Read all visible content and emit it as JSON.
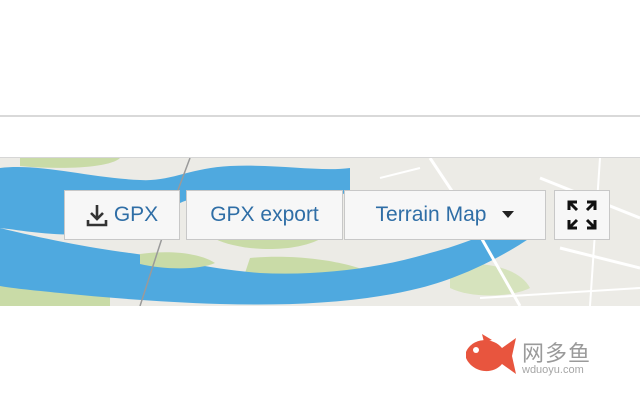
{
  "toolbar": {
    "gpx_label": "GPX",
    "gpx_export_label": "GPX export",
    "map_type_label": "Terrain Map"
  },
  "watermark": {
    "name": "网多鱼",
    "url": "wduoyu.com"
  },
  "colors": {
    "water": "#4fa9df",
    "land": "#ecebe6",
    "park": "#c9dba7",
    "button_text": "#2f6ea6",
    "button_bg": "#f7f7f7",
    "watermark_fish": "#e8553e"
  },
  "icons": {
    "gpx_button": "download-icon",
    "map_type_button": "caret-down-icon",
    "fullscreen_button": "expand-icon",
    "watermark_logo": "fish-icon"
  }
}
